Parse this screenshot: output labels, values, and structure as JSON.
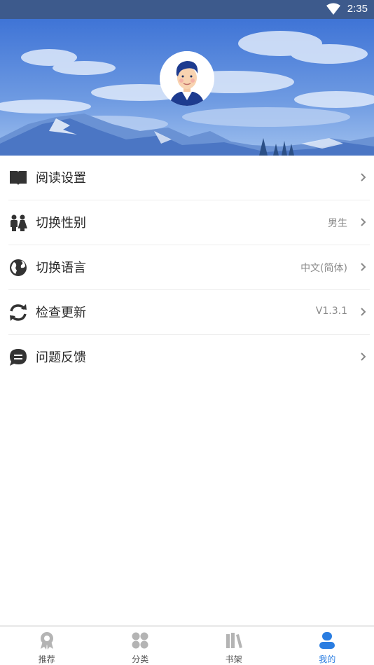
{
  "status_bar": {
    "time": "2:35",
    "wifi_icon": "wifi-icon"
  },
  "profile": {
    "avatar_icon": "user-avatar"
  },
  "menu": [
    {
      "icon": "book-icon",
      "label": "阅读设置",
      "value": ""
    },
    {
      "icon": "gender-icon",
      "label": "切换性别",
      "value": "男生"
    },
    {
      "icon": "globe-icon",
      "label": "切换语言",
      "value": "中文(简体)"
    },
    {
      "icon": "refresh-icon",
      "label": "检查更新",
      "value": "V1.3.1"
    },
    {
      "icon": "chat-icon",
      "label": "问题反馈",
      "value": ""
    }
  ],
  "tabs": [
    {
      "icon": "award-icon",
      "label": "推荐",
      "active": false
    },
    {
      "icon": "grid-icon",
      "label": "分类",
      "active": false
    },
    {
      "icon": "bookshelf-icon",
      "label": "书架",
      "active": false
    },
    {
      "icon": "person-icon",
      "label": "我的",
      "active": true
    }
  ],
  "colors": {
    "accent": "#2a7de1",
    "status_bar": "#3d5a8c",
    "icon": "#333333",
    "inactive_tab": "#b4b4b4"
  }
}
